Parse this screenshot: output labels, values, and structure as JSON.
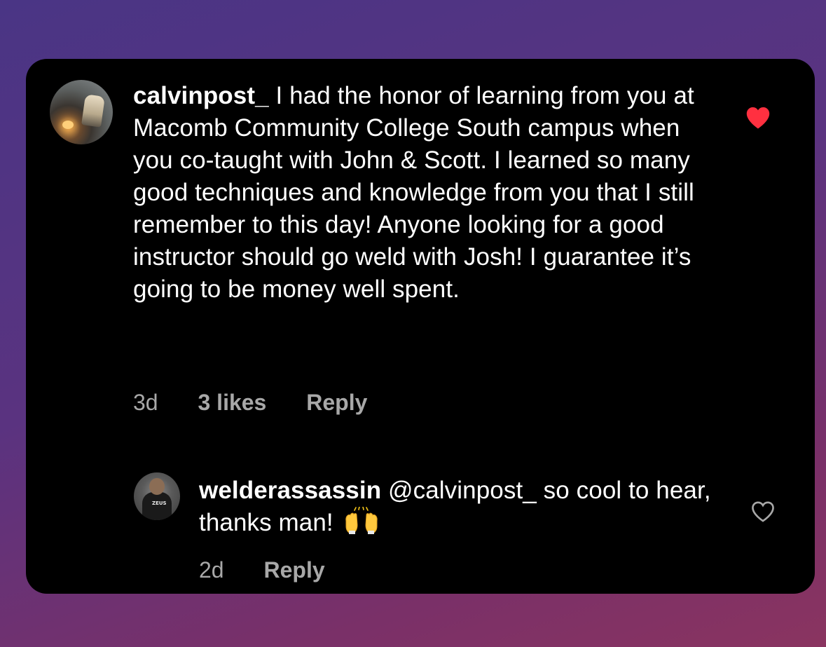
{
  "comment": {
    "username": "calvinpost_",
    "text": "I had the honor of learning from you at Macomb Community College South campus when you co-taught with John & Scott. I learned so many good techniques and knowledge from you that I still remember to this day! Anyone looking for a good instructor should go weld with Josh! I guarantee it’s going to be money well spent.",
    "time": "3d",
    "likes": "3 likes",
    "reply_label": "Reply",
    "liked": true,
    "like_icon": "heart-filled-icon",
    "like_color": "#ff3040"
  },
  "reply": {
    "username": "welderassassin",
    "text": "@calvinpost_ so cool to hear, thanks man!",
    "emoji": "raising-hands-icon",
    "avatar_shirt_text": "ZEUS",
    "time": "2d",
    "reply_label": "Reply",
    "liked": false,
    "like_icon": "heart-outline-icon"
  },
  "colors": {
    "card_background": "#000000",
    "text_primary": "#ffffff",
    "text_secondary": "#a8a8a8",
    "background_gradient_start": "#4a3585",
    "background_gradient_end": "#8a3460"
  }
}
